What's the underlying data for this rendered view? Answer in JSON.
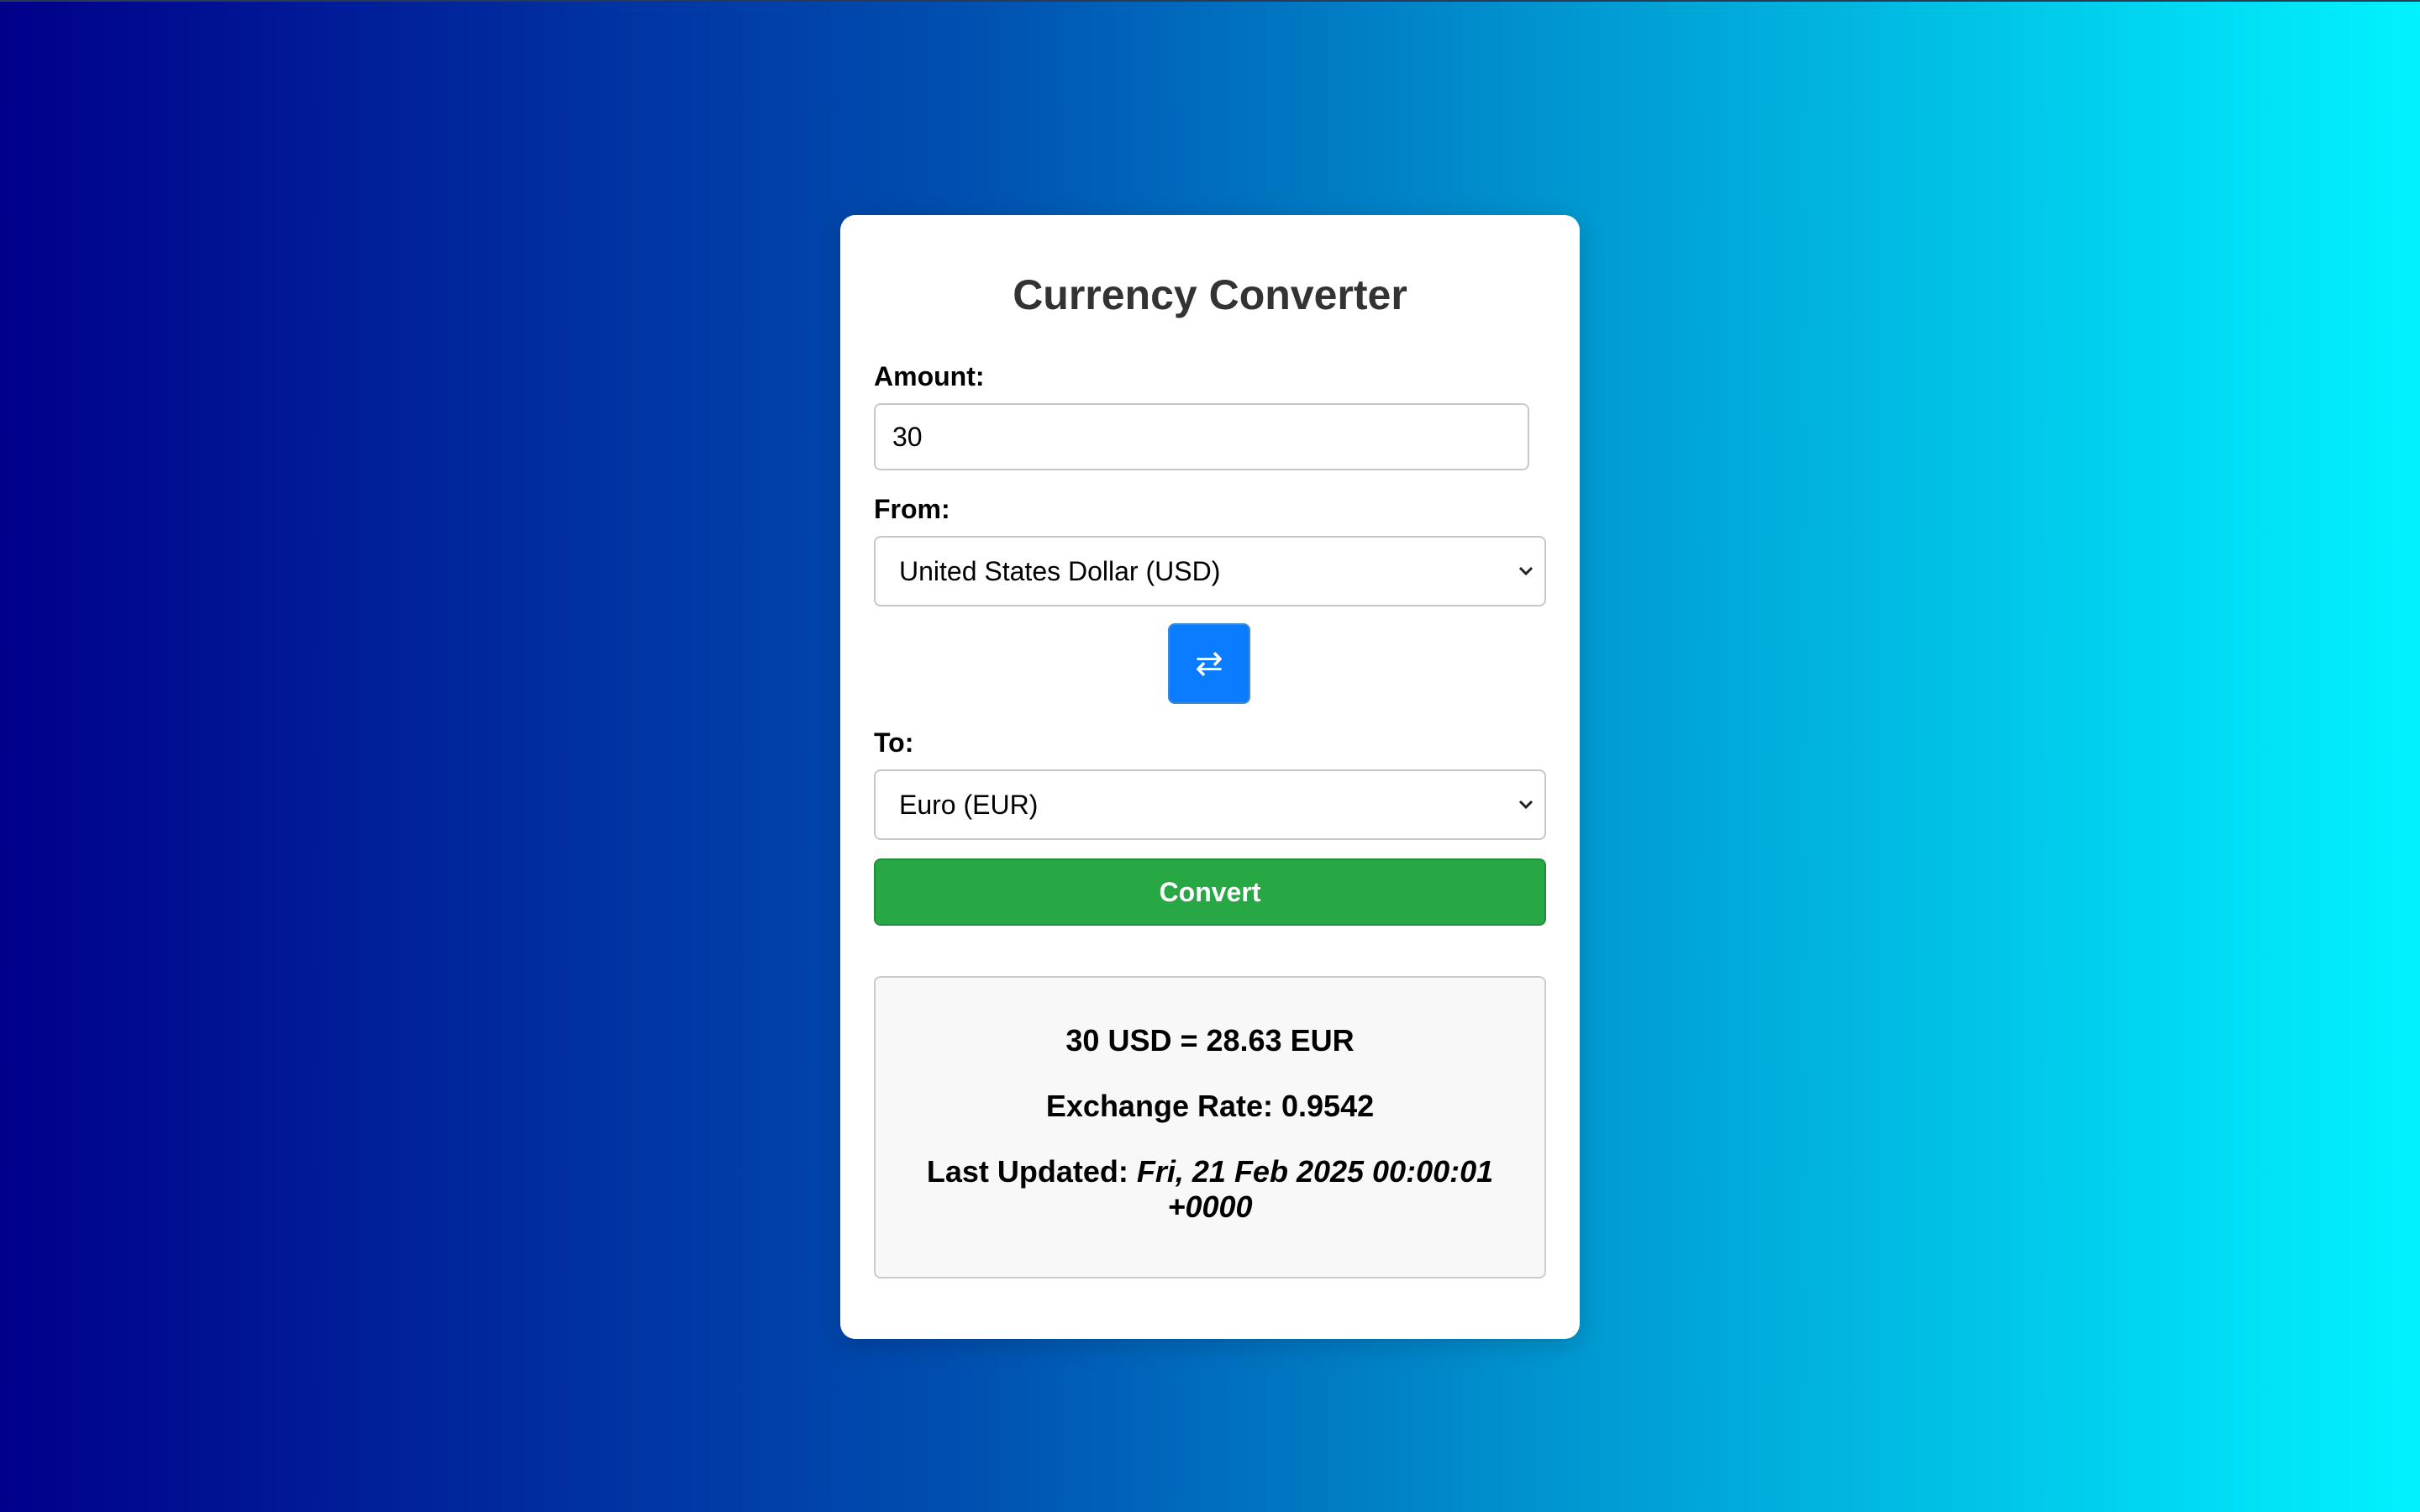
{
  "title": "Currency Converter",
  "amount": {
    "label": "Amount:",
    "value": "30"
  },
  "from": {
    "label": "From:",
    "selected": "United States Dollar (USD)"
  },
  "swap": {
    "glyph": "⇄",
    "icon": "swap-arrows-icon"
  },
  "to": {
    "label": "To:",
    "selected": "Euro (EUR)"
  },
  "convert_label": "Convert",
  "result": {
    "conversion": "30 USD = 28.63 EUR",
    "rate_label": "Exchange Rate:",
    "rate_value": "0.9542",
    "updated_label": "Last Updated:",
    "updated_value": "Fri, 21 Feb 2025 00:00:01 +0000"
  },
  "colors": {
    "swap_button": "#0a7cff",
    "convert_button": "#28a745",
    "gradient_start": "#00008b",
    "gradient_end": "#00f2ff"
  }
}
